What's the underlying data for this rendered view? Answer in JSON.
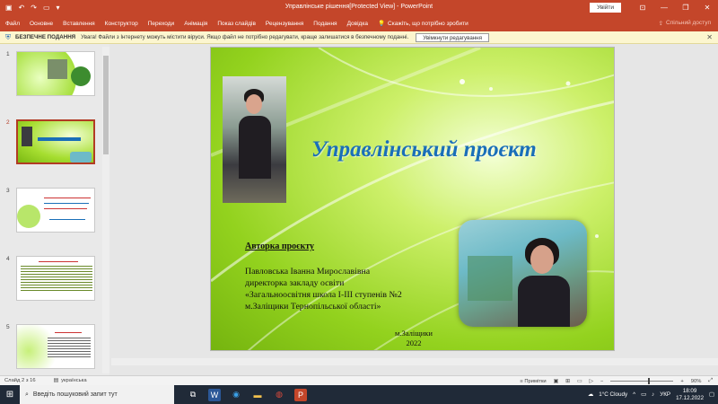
{
  "window": {
    "title": "Управлінське рішення[Protected View]  -  PowerPoint",
    "signin_label": "Увійти",
    "minimize_glyph": "—",
    "restore_glyph": "❐",
    "close_glyph": "✕"
  },
  "ribbon": {
    "tabs": [
      "Файл",
      "Основне",
      "Вставлення",
      "Конструктор",
      "Переходи",
      "Анімація",
      "Показ слайдів",
      "Рецензування",
      "Подання",
      "Довідка"
    ],
    "tell_me": "Скажіть, що потрібно зробити",
    "share": "Спільний доступ"
  },
  "message_bar": {
    "title": "БЕЗПЕЧНЕ ПОДАННЯ",
    "text": "Увага! Файли з Інтернету можуть містити віруси. Якщо файл не потрібно редагувати, краще залишатися в безпечному поданні.",
    "enable_button": "Увімкнути редагування"
  },
  "thumbnails": [
    {
      "num": "1"
    },
    {
      "num": "2"
    },
    {
      "num": "3"
    },
    {
      "num": "4"
    },
    {
      "num": "5"
    }
  ],
  "slide": {
    "title": "Управлінський проєкт",
    "author_heading": "Авторка проєкту",
    "author_lines": [
      "Павловська Іванна Мирославівна",
      "директорка закладу освіти",
      "«Загальноосвітня школа І-ІІІ ступенів №2",
      "м.Заліщики Тернопільської області»"
    ],
    "city": "м.Заліщики",
    "year": "2022"
  },
  "status": {
    "slide_counter": "Слайд 2 з 16",
    "language": "українська",
    "notes": "Примітки",
    "zoom": "90%"
  },
  "taskbar": {
    "search_placeholder": "Введіть пошуковий запит тут",
    "weather": "1°C  Cloudy",
    "lang": "УКР",
    "time": "18:09",
    "date": "17.12.2022"
  },
  "colors": {
    "accent": "#c4462a",
    "title_blue": "#1a6fb8",
    "slide_green": "#93d21e"
  }
}
